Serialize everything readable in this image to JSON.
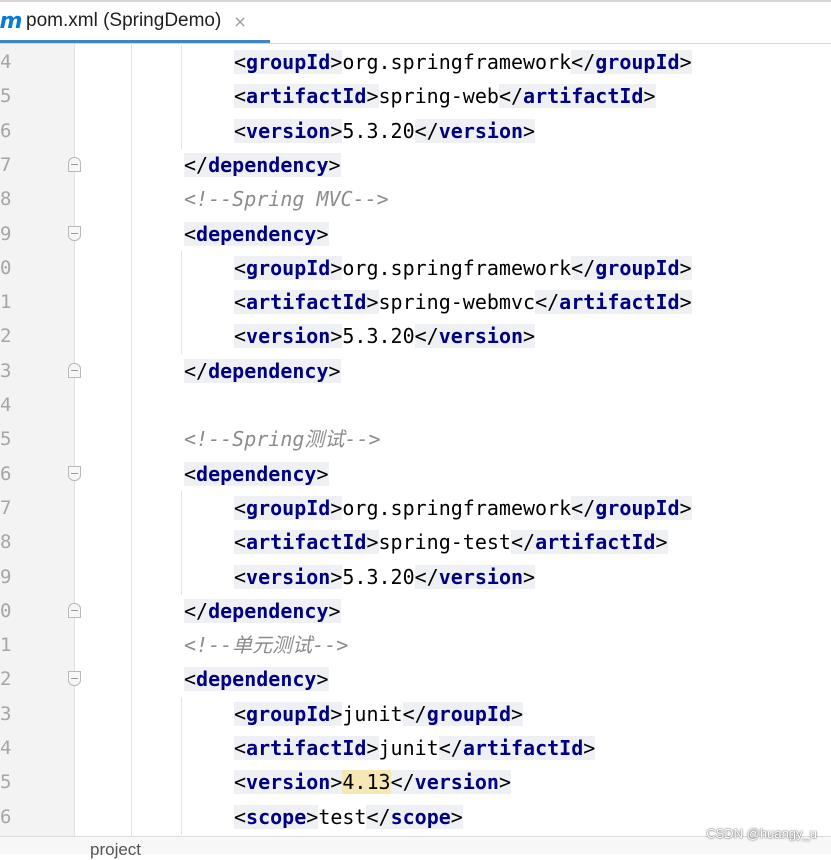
{
  "tab": {
    "icon": "maven-m-icon",
    "icon_glyph": "m",
    "title": "pom.xml (SpringDemo)",
    "close_glyph": "×"
  },
  "breadcrumb": "project",
  "watermark": "CSDN @huangy_u",
  "colors": {
    "tag_name": "#000080",
    "comment": "#8c8c8c",
    "tag_background": "#eef0f3",
    "highlight": "#f6e7b5",
    "tab_underline": "#4083c9"
  },
  "lines": [
    {
      "num": "4",
      "indent": 2,
      "kind": "elem",
      "tag": "groupId",
      "text": "org.springframework"
    },
    {
      "num": "5",
      "indent": 2,
      "kind": "elem",
      "tag": "artifactId",
      "text": "spring-web"
    },
    {
      "num": "6",
      "indent": 2,
      "kind": "elem",
      "tag": "version",
      "text": "5.3.20"
    },
    {
      "num": "7",
      "indent": 1,
      "kind": "close",
      "tag": "dependency",
      "fold": "close"
    },
    {
      "num": "8",
      "indent": 1,
      "kind": "comment",
      "text": "<!--Spring MVC-->"
    },
    {
      "num": "9",
      "indent": 1,
      "kind": "open",
      "tag": "dependency",
      "fold": "open"
    },
    {
      "num": "0",
      "indent": 2,
      "kind": "elem",
      "tag": "groupId",
      "text": "org.springframework"
    },
    {
      "num": "1",
      "indent": 2,
      "kind": "elem",
      "tag": "artifactId",
      "text": "spring-webmvc"
    },
    {
      "num": "2",
      "indent": 2,
      "kind": "elem",
      "tag": "version",
      "text": "5.3.20"
    },
    {
      "num": "3",
      "indent": 1,
      "kind": "close",
      "tag": "dependency",
      "fold": "close"
    },
    {
      "num": "4",
      "indent": 0,
      "kind": "blank"
    },
    {
      "num": "5",
      "indent": 1,
      "kind": "comment",
      "text": "<!--Spring测试-->"
    },
    {
      "num": "6",
      "indent": 1,
      "kind": "open",
      "tag": "dependency",
      "fold": "open"
    },
    {
      "num": "7",
      "indent": 2,
      "kind": "elem",
      "tag": "groupId",
      "text": "org.springframework"
    },
    {
      "num": "8",
      "indent": 2,
      "kind": "elem",
      "tag": "artifactId",
      "text": "spring-test"
    },
    {
      "num": "9",
      "indent": 2,
      "kind": "elem",
      "tag": "version",
      "text": "5.3.20"
    },
    {
      "num": "0",
      "indent": 1,
      "kind": "close",
      "tag": "dependency",
      "fold": "close"
    },
    {
      "num": "1",
      "indent": 1,
      "kind": "comment",
      "text": "<!--单元测试-->"
    },
    {
      "num": "2",
      "indent": 1,
      "kind": "open",
      "tag": "dependency",
      "fold": "open"
    },
    {
      "num": "3",
      "indent": 2,
      "kind": "elem",
      "tag": "groupId",
      "text": "junit"
    },
    {
      "num": "4",
      "indent": 2,
      "kind": "elem",
      "tag": "artifactId",
      "text": "junit"
    },
    {
      "num": "5",
      "indent": 2,
      "kind": "elem",
      "tag": "version",
      "text": "4.13",
      "highlight": true
    },
    {
      "num": "6",
      "indent": 2,
      "kind": "elem",
      "tag": "scope",
      "text": "test"
    }
  ]
}
